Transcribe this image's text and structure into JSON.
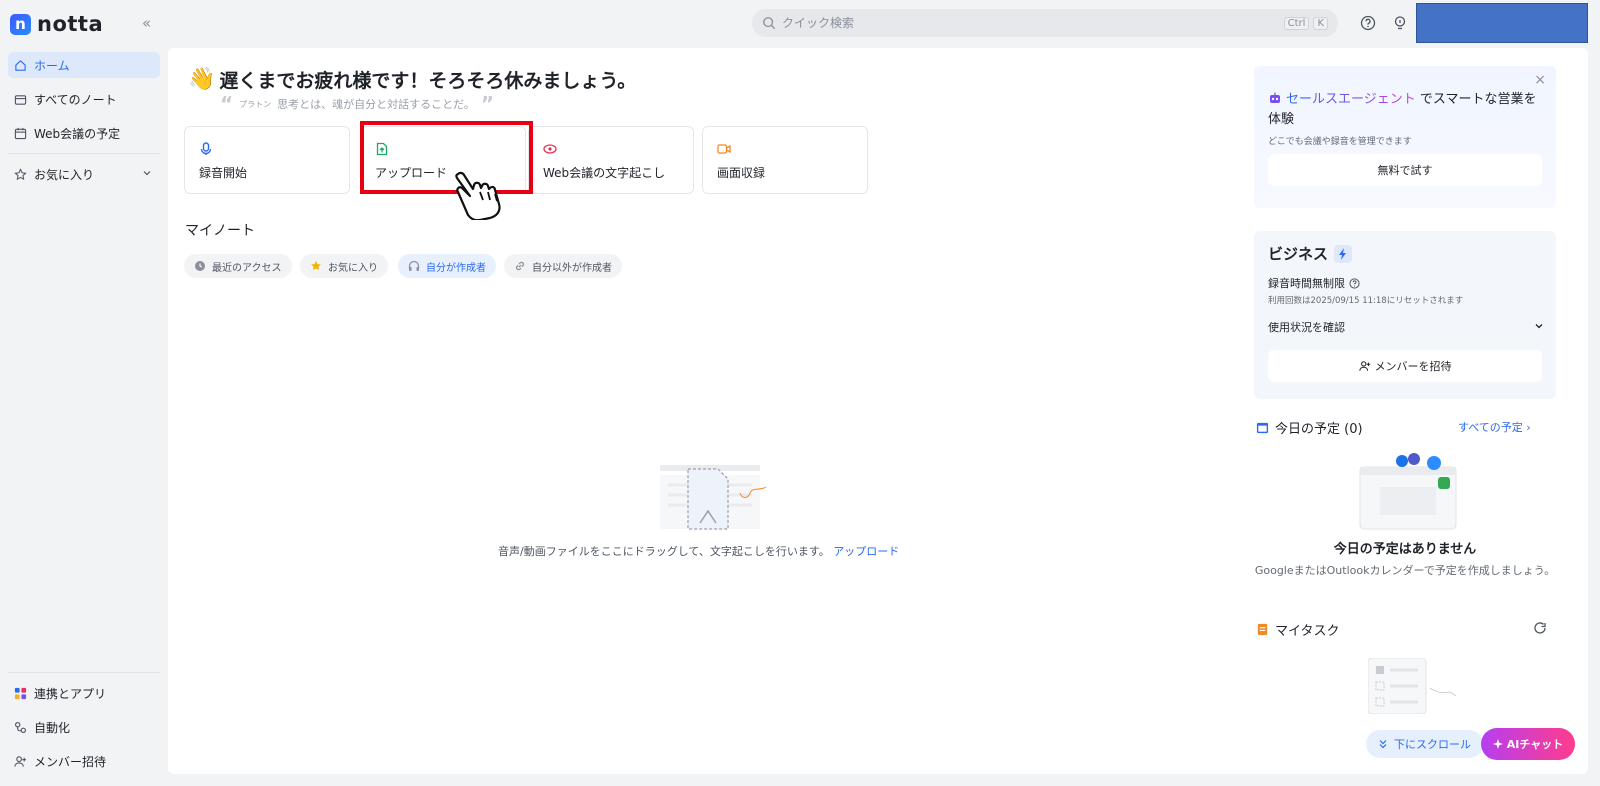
{
  "app": {
    "logo_letter": "n",
    "name": "notta"
  },
  "search": {
    "placeholder": "クイック検索",
    "shortcut_ctrl": "Ctrl",
    "shortcut_key": "K"
  },
  "sidebar": {
    "top_items": [
      {
        "label": "ホーム",
        "icon": "home-icon",
        "active": true
      },
      {
        "label": "すべてのノート",
        "icon": "folder-icon"
      },
      {
        "label": "Web会議の予定",
        "icon": "calendar-icon"
      }
    ],
    "favorites": {
      "label": "お気に入り",
      "icon": "star-icon"
    },
    "bottom_items": [
      {
        "label": "連携とアプリ",
        "icon": "apps-icon"
      },
      {
        "label": "自動化",
        "icon": "automation-icon"
      },
      {
        "label": "メンバー招待",
        "icon": "add-member-icon"
      }
    ]
  },
  "greeting": {
    "title": "遅くまでお疲れ様です！そろそろ休みましょう。",
    "quote_author": "プラトン",
    "quote_text": "思考とは、魂が自分と対話することだ。"
  },
  "actions": [
    {
      "label": "録音開始",
      "icon": "microphone-icon",
      "color": "#2a6af0"
    },
    {
      "label": "アップロード",
      "icon": "upload-icon",
      "color": "#1aa86b"
    },
    {
      "label": "Web会議の文字起こし",
      "icon": "meeting-icon",
      "color": "#e8305a"
    },
    {
      "label": "画面収録",
      "icon": "screen-record-icon",
      "color": "#f08a24"
    }
  ],
  "notes": {
    "title": "マイノート",
    "filters": [
      {
        "label": "最近のアクセス",
        "icon": "clock-icon"
      },
      {
        "label": "お気に入り",
        "icon": "star-icon"
      },
      {
        "label": "自分が作成者",
        "icon": "headphones-icon",
        "active": true
      },
      {
        "label": "自分以外が作成者",
        "icon": "link-icon"
      }
    ],
    "empty_text": "音声/動画ファイルをここにドラッグして、文字起こしを行います。",
    "empty_link": "アップロード"
  },
  "promo": {
    "accent": "セールスエージェント",
    "title_rest": "でスマートな営業を体験",
    "subtitle": "どこでも会議や録音を管理できます",
    "button": "無料で試す"
  },
  "plan": {
    "name": "ビジネス",
    "line1": "録音時間無制限",
    "line2": "利用回数は2025/09/15 11:18にリセットされます",
    "usage": "使用状況を確認",
    "invite": "メンバーを招待"
  },
  "schedule": {
    "title": "今日の予定 (0)",
    "link": "すべての予定 ›",
    "empty_title": "今日の予定はありません",
    "empty_desc": "GoogleまたはOutlookカレンダーで予定を作成しましょう。"
  },
  "tasks": {
    "title": "マイタスク"
  },
  "floating": {
    "scroll": "下にスクロール",
    "ai": "AIチャット"
  },
  "colors": {
    "accent": "#2a6af0",
    "highlight": "#e60012"
  }
}
